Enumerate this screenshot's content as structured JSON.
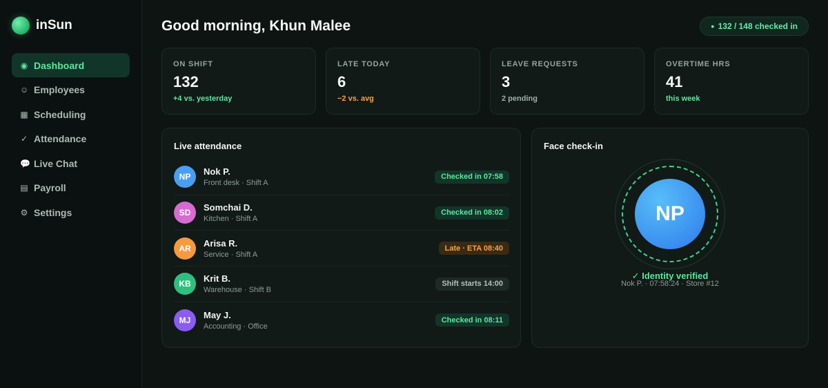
{
  "app": {
    "name": "inSun"
  },
  "sidebar": {
    "items": [
      {
        "label": "Dashboard",
        "icon": "◉",
        "active": true
      },
      {
        "label": "Employees",
        "icon": "☺"
      },
      {
        "label": "Scheduling",
        "icon": "▦"
      },
      {
        "label": "Attendance",
        "icon": "✓"
      },
      {
        "label": "Live Chat",
        "icon": "💬"
      },
      {
        "label": "Payroll",
        "icon": "▤"
      },
      {
        "label": "Settings",
        "icon": "⚙"
      }
    ]
  },
  "header": {
    "greeting": "Good morning, Khun Malee",
    "checkin_summary": "132 / 148 checked in",
    "checkin_dot": "●"
  },
  "stats": [
    {
      "label": "ON SHIFT",
      "value": "132",
      "sub": "+4 vs. yesterday",
      "tone": "green"
    },
    {
      "label": "LATE TODAY",
      "value": "6",
      "sub": "−2 vs. avg",
      "tone": "orange"
    },
    {
      "label": "LEAVE REQUESTS",
      "value": "3",
      "sub": "2 pending",
      "tone": "gray"
    },
    {
      "label": "OVERTIME HRS",
      "value": "41",
      "sub": "this week",
      "tone": "green"
    }
  ],
  "attendance": {
    "title": "Live attendance",
    "rows": [
      {
        "initials": "NP",
        "name": "Nok P.",
        "role": "Front desk · Shift A",
        "status": "Checked in 07:58",
        "status_tone": "green",
        "avatar_color": "#4a9ef2"
      },
      {
        "initials": "SD",
        "name": "Somchai D.",
        "role": "Kitchen · Shift A",
        "status": "Checked in 08:02",
        "status_tone": "green",
        "avatar_color": "#d66bd0"
      },
      {
        "initials": "AR",
        "name": "Arisa R.",
        "role": "Service · Shift A",
        "status": "Late · ETA 08:40",
        "status_tone": "orange",
        "avatar_color": "#f59a3e"
      },
      {
        "initials": "KB",
        "name": "Krit B.",
        "role": "Warehouse · Shift B",
        "status": "Shift starts 14:00",
        "status_tone": "gray",
        "avatar_color": "#2fbf7f"
      },
      {
        "initials": "MJ",
        "name": "May J.",
        "role": "Accounting · Office",
        "status": "Checked in 08:11",
        "status_tone": "green",
        "avatar_color": "#8a5cf0"
      }
    ]
  },
  "face_checkin": {
    "title": "Face check-in",
    "initials": "NP",
    "status": "✓ Identity verified",
    "meta": "Nok P. · 07:58:24 · Store #12"
  },
  "colors": {
    "accent": "#5ee6a0",
    "warning": "#f5a24a",
    "background": "#0d1412",
    "card": "#111a17"
  }
}
